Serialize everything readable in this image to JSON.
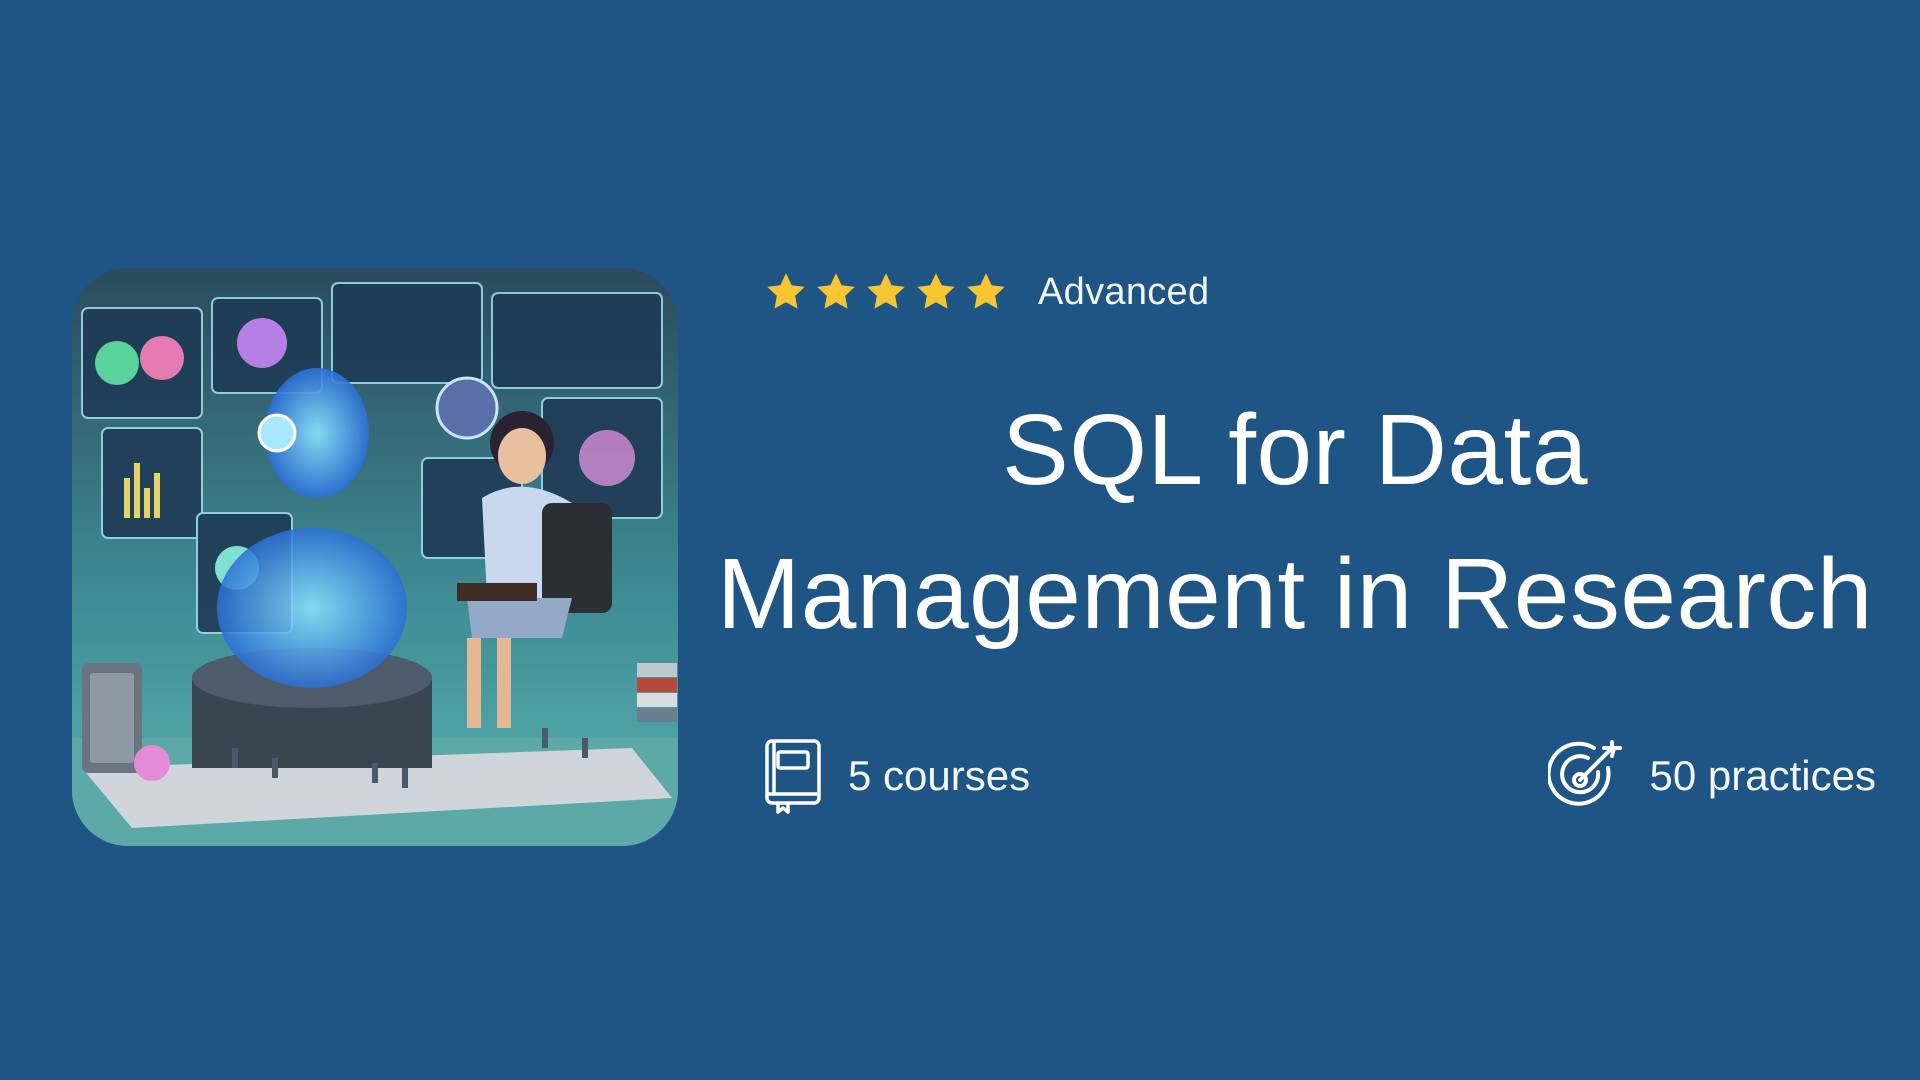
{
  "hero": {
    "illustration_name": "ai-data-research-illustration",
    "rating": {
      "stars": 5,
      "max": 5,
      "color": "#f7c531"
    },
    "level": "Advanced",
    "title_line1": "SQL for Data",
    "title_line2": "Management in Research"
  },
  "stats": {
    "courses": {
      "icon": "book-icon",
      "label": "5 courses"
    },
    "practices": {
      "icon": "target-icon",
      "label": "50 practices"
    }
  },
  "colors": {
    "background": "#1e5585",
    "text": "#ffffff",
    "star": "#f7c531"
  }
}
